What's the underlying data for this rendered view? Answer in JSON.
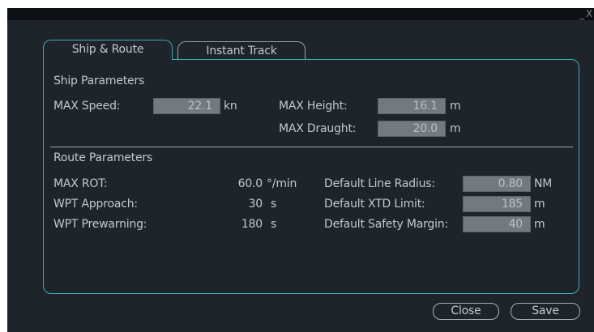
{
  "window": {
    "minimize_glyph": "_",
    "close_glyph": "X"
  },
  "tabs": [
    {
      "label": "Ship & Route",
      "active": true
    },
    {
      "label": "Instant Track",
      "active": false
    }
  ],
  "ship": {
    "section_title": "Ship Parameters",
    "max_speed": {
      "label": "MAX Speed:",
      "value": "22.1",
      "unit": "kn"
    },
    "max_height": {
      "label": "MAX Height:",
      "value": "16.1",
      "unit": "m"
    },
    "max_draught": {
      "label": "MAX Draught:",
      "value": "20.0",
      "unit": "m"
    }
  },
  "route": {
    "section_title": "Route Parameters",
    "max_rot": {
      "label": "MAX ROT:",
      "value": "60.0",
      "unit": "°/min"
    },
    "wpt_approach": {
      "label": "WPT Approach:",
      "value": "30",
      "unit": "s"
    },
    "wpt_prewarning": {
      "label": "WPT Prewarning:",
      "value": "180",
      "unit": "s"
    },
    "line_radius": {
      "label": "Default Line Radius:",
      "value": "0.80",
      "unit": "NM"
    },
    "xtd_limit": {
      "label": "Default XTD Limit:",
      "value": "185",
      "unit": "m"
    },
    "safety_margin": {
      "label": "Default Safety Margin:",
      "value": "40",
      "unit": "m"
    }
  },
  "buttons": {
    "close": "Close",
    "save": "Save"
  },
  "colors": {
    "background": "#1e242a",
    "titlebar": "#0d1114",
    "accent": "#3ea8b8",
    "field": "#73797e",
    "text": "#c2c8cc"
  }
}
